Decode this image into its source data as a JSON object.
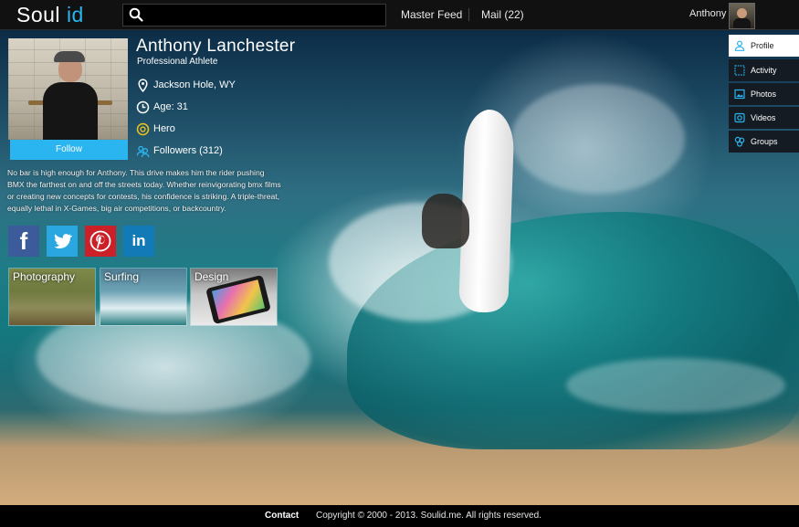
{
  "header": {
    "logo_part1": "Soul",
    "logo_part2": "id",
    "search_placeholder": "",
    "nav": {
      "master_feed": "Master Feed",
      "mail": "Mail (22)"
    },
    "user_name": "Anthony"
  },
  "profile": {
    "name": "Anthony Lanchester",
    "role": "Professional Athlete",
    "follow_label": "Follow",
    "location": "Jackson Hole, WY",
    "age": "Age: 31",
    "rank": "Hero",
    "followers": "Followers (312)",
    "bio": "No bar is high enough for Anthony. This drive makes him the rider pushing BMX the farthest on and off the streets today. Whether reinvigorating bmx films or creating new concepts for contests, his confidence is striking. A triple-threat, equally lethal in X-Games, big air competitions, or backcountry."
  },
  "social": [
    "facebook-icon",
    "twitter-icon",
    "pinterest-icon",
    "linkedin-icon"
  ],
  "interests": [
    {
      "label": "Photography"
    },
    {
      "label": "Surfing"
    },
    {
      "label": "Design"
    }
  ],
  "side_menu": [
    {
      "label": "Profile",
      "icon": "user-icon",
      "active": true
    },
    {
      "label": "Activity",
      "icon": "activity-icon"
    },
    {
      "label": "Photos",
      "icon": "photos-icon"
    },
    {
      "label": "Videos",
      "icon": "videos-icon"
    },
    {
      "label": "Groups",
      "icon": "groups-icon"
    }
  ],
  "footer": {
    "contact": "Contact",
    "copyright": "Copyright © 2000 - 2013. Soulid.me. All rights reserved."
  },
  "colors": {
    "accent": "#2ab4f0",
    "topbar": "#111111",
    "footer": "#000000"
  }
}
